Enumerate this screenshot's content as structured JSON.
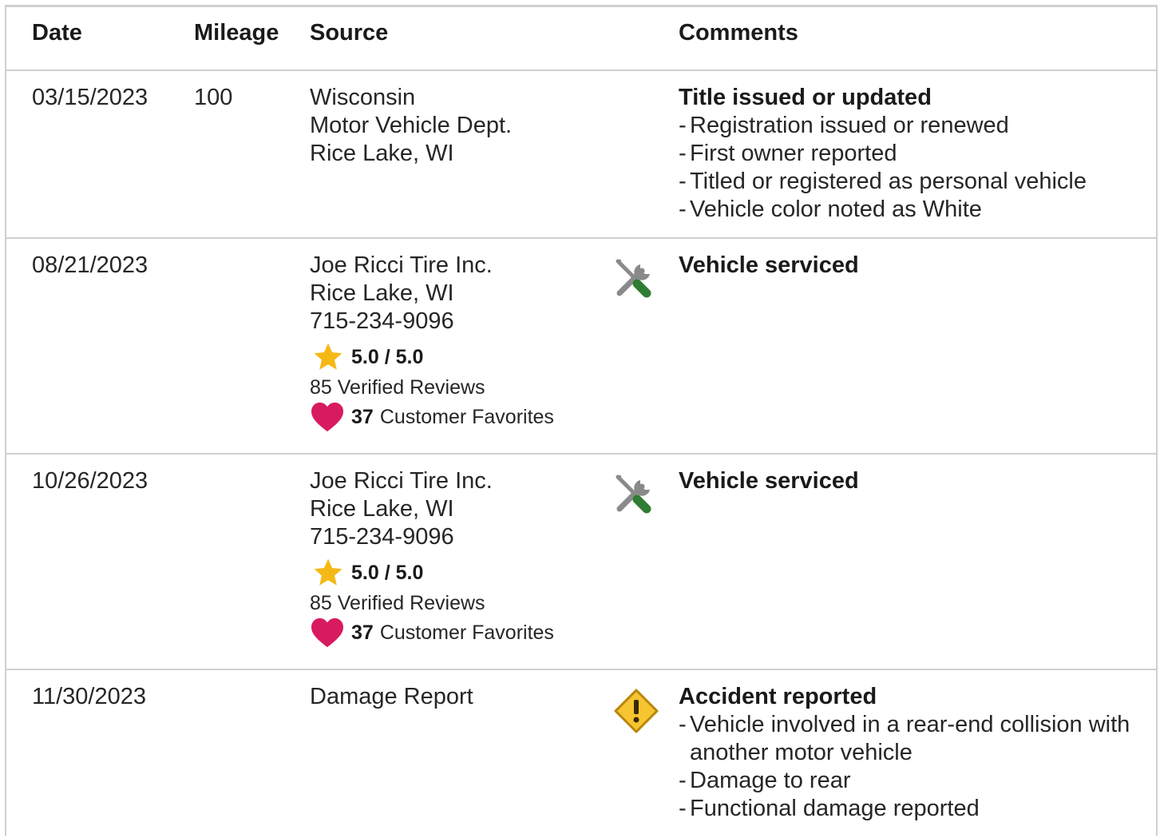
{
  "columns": {
    "date": "Date",
    "mileage": "Mileage",
    "source": "Source",
    "comments": "Comments"
  },
  "colors": {
    "border": "#cfcfcf",
    "star": "#f5b915",
    "heart": "#d81b60",
    "wrench_gray": "#8a8a8a",
    "screwdriver_green": "#2e7d32",
    "warning_fill": "#f7c531",
    "warning_stroke": "#b8860b"
  },
  "records": [
    {
      "date": "03/15/2023",
      "mileage": "100",
      "source": [
        "Wisconsin",
        "Motor Vehicle Dept.",
        "Rice Lake, WI"
      ],
      "icon": "none",
      "comment_title": "Title issued or updated",
      "comment_items": [
        "Registration issued or renewed",
        "First owner reported",
        "Titled or registered as personal vehicle",
        "Vehicle color noted as White"
      ]
    },
    {
      "date": "08/21/2023",
      "mileage": "",
      "source": [
        "Joe Ricci Tire Inc.",
        "Rice Lake, WI",
        "715-234-9096"
      ],
      "rating": "5.0 / 5.0",
      "reviews": "85 Verified Reviews",
      "favorites_count": "37",
      "favorites_label": "Customer Favorites",
      "icon": "service-tools-icon",
      "comment_title": "Vehicle serviced",
      "comment_items": []
    },
    {
      "date": "10/26/2023",
      "mileage": "",
      "source": [
        "Joe Ricci Tire Inc.",
        "Rice Lake, WI",
        "715-234-9096"
      ],
      "rating": "5.0 / 5.0",
      "reviews": "85 Verified Reviews",
      "favorites_count": "37",
      "favorites_label": "Customer Favorites",
      "icon": "service-tools-icon",
      "comment_title": "Vehicle serviced",
      "comment_items": []
    },
    {
      "date": "11/30/2023",
      "mileage": "",
      "source": [
        "Damage Report"
      ],
      "icon": "warning-icon",
      "comment_title": "Accident reported",
      "comment_items": [
        "Vehicle involved in a rear-end collision with another motor vehicle",
        "Damage to rear",
        "Functional damage reported"
      ]
    }
  ]
}
